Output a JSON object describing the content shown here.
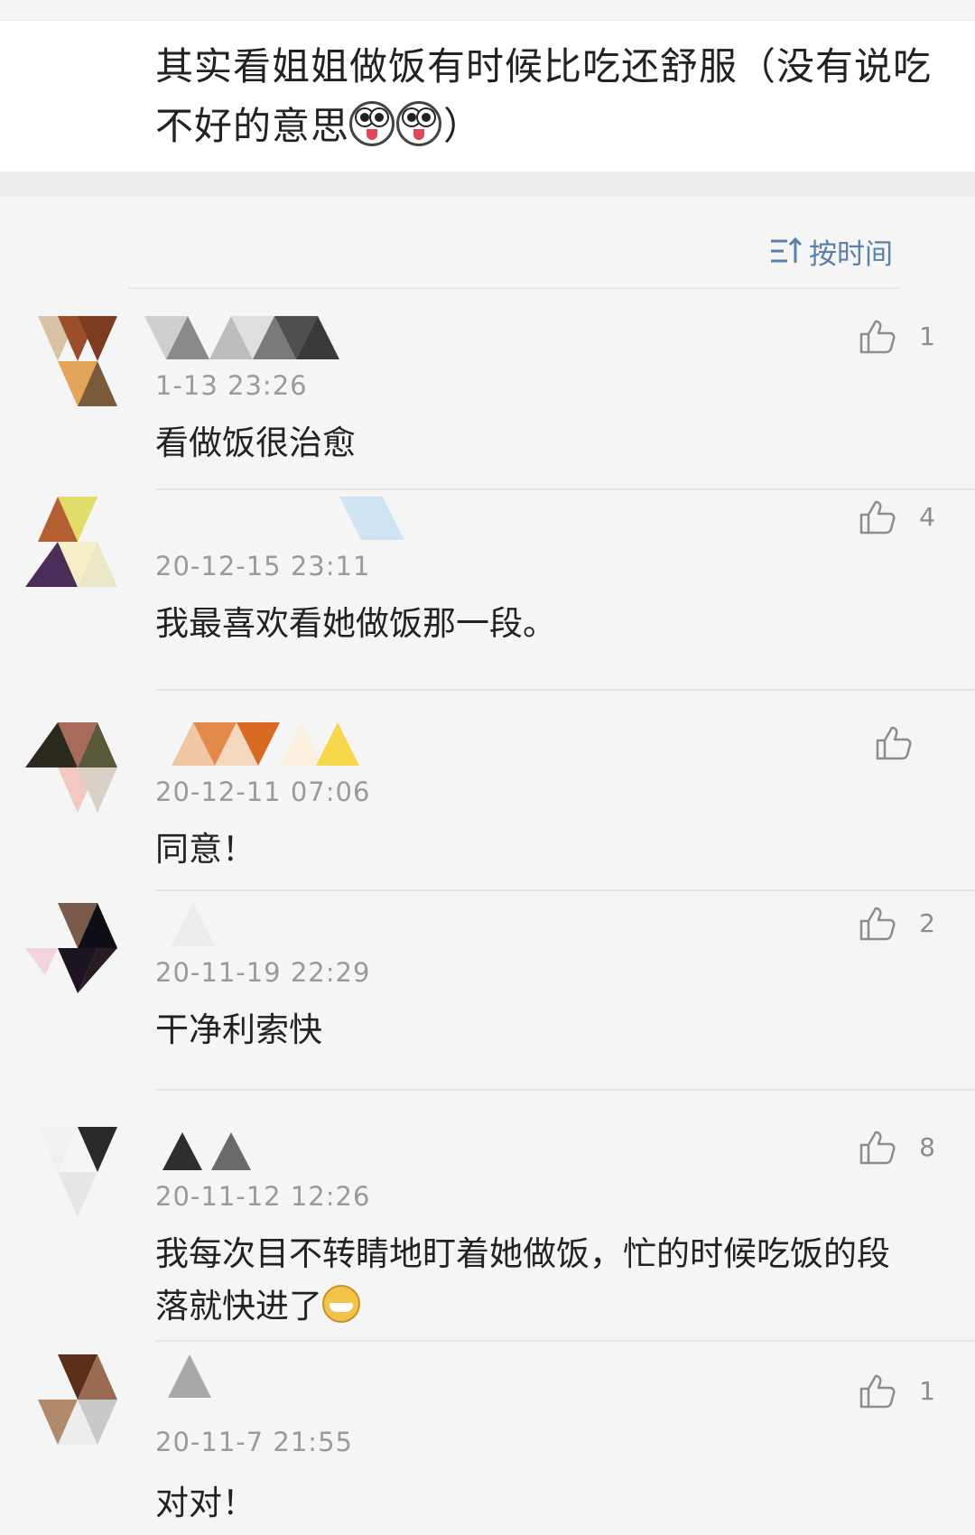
{
  "post": {
    "text_line1": "其实看姐姐做饭有时候比吃还舒服（没有说吃",
    "text_line2_prefix": "不好的意思",
    "text_line2_suffix": "）"
  },
  "sort": {
    "label": "按时间"
  },
  "comments": [
    {
      "time": "1-13 23:26",
      "text": "看做饭很治愈",
      "likes": "1"
    },
    {
      "time": "20-12-15 23:11",
      "text": "我最喜欢看她做饭那一段。",
      "likes": "4"
    },
    {
      "time": "20-12-11 07:06",
      "text": "同意！",
      "likes": ""
    },
    {
      "time": "20-11-19 22:29",
      "text": "干净利索快",
      "likes": "2"
    },
    {
      "time": "20-11-12 12:26",
      "text_line1": "我每次目不转睛地盯着她做饭，忙的时候吃饭的段",
      "text_line2": "落就快进了",
      "likes": "8"
    },
    {
      "time": "20-11-7 21:55",
      "text": "对对！",
      "likes": "1"
    }
  ],
  "colors": {
    "accent": "#5a7fa8",
    "timestamp": "#9a9a9a",
    "background": "#f5f5f5"
  },
  "icons": [
    "sort-icon",
    "thumbs-up-icon",
    "emoji-face-icon",
    "grin-emoji-icon"
  ]
}
